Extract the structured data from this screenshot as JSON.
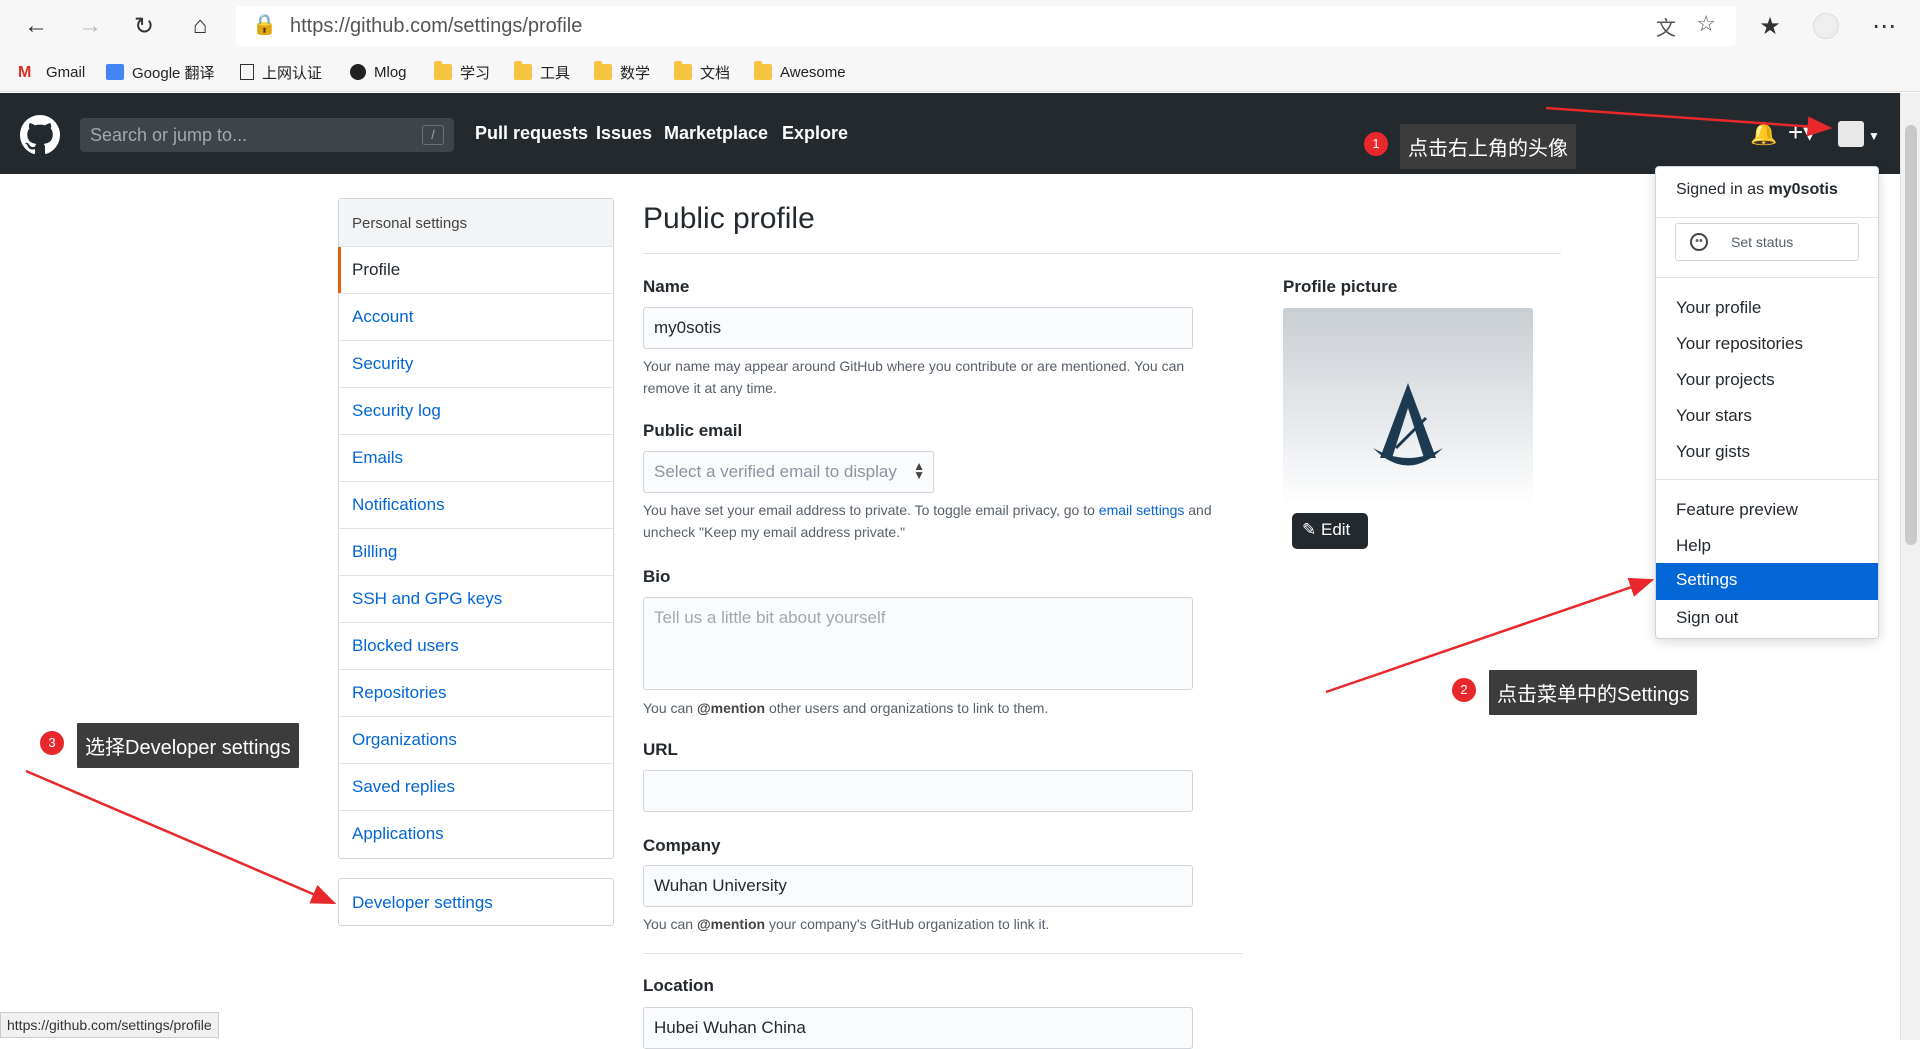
{
  "browser": {
    "url": "https://github.com/settings/profile",
    "bookmarks": [
      "Gmail",
      "Google 翻译",
      "上网认证",
      "Mlog",
      "学习",
      "工具",
      "数学",
      "文档",
      "Awesome"
    ]
  },
  "github_header": {
    "search_placeholder": "Search or jump to...",
    "search_shortcut": "/",
    "nav": [
      "Pull requests",
      "Issues",
      "Marketplace",
      "Explore"
    ]
  },
  "sidebar": {
    "heading": "Personal settings",
    "items": [
      "Profile",
      "Account",
      "Security",
      "Security log",
      "Emails",
      "Notifications",
      "Billing",
      "SSH and GPG keys",
      "Blocked users",
      "Repositories",
      "Organizations",
      "Saved replies",
      "Applications"
    ],
    "selected": "Profile",
    "developer_settings": "Developer settings"
  },
  "main": {
    "title": "Public profile",
    "name_label": "Name",
    "name_value": "my0sotis",
    "name_note": "Your name may appear around GitHub where you contribute or are mentioned. You can remove it at any time.",
    "public_email_label": "Public email",
    "email_placeholder": "Select a verified email to display",
    "email_note_prefix": "You have set your email address to private. To toggle email privacy, go to ",
    "email_note_link": "email settings",
    "email_note_suffix": "and uncheck \"Keep my email address private.\"",
    "bio_label": "Bio",
    "bio_placeholder": "Tell us a little bit about yourself",
    "bio_note_prefix": "You can ",
    "bio_note_mention": "@mention",
    "bio_note_suffix": " other users and organizations to link to them.",
    "url_label": "URL",
    "url_value": "",
    "company_label": "Company",
    "company_value": "Wuhan University",
    "company_note_prefix": "You can ",
    "company_note_mention": "@mention",
    "company_note_suffix": " your company's GitHub organization to link it.",
    "location_label": "Location",
    "location_value": "Hubei Wuhan China",
    "profile_picture_label": "Profile picture",
    "edit_label": "Edit"
  },
  "dropdown": {
    "signed_in_prefix": "Signed in as ",
    "username": "my0sotis",
    "set_status": "Set status",
    "group1": [
      "Your profile",
      "Your repositories",
      "Your projects",
      "Your stars",
      "Your gists"
    ],
    "group2": [
      "Feature preview",
      "Help",
      "Settings",
      "Sign out"
    ],
    "active": "Settings"
  },
  "annotations": {
    "step1_num": "1",
    "step1_text": "点击右上角的头像",
    "step2_num": "2",
    "step2_text": "点击菜单中的Settings",
    "step3_num": "3",
    "step3_text": "选择Developer settings",
    "arrow_color": "#e8282b"
  },
  "status_bar_url": "https://github.com/settings/profile"
}
